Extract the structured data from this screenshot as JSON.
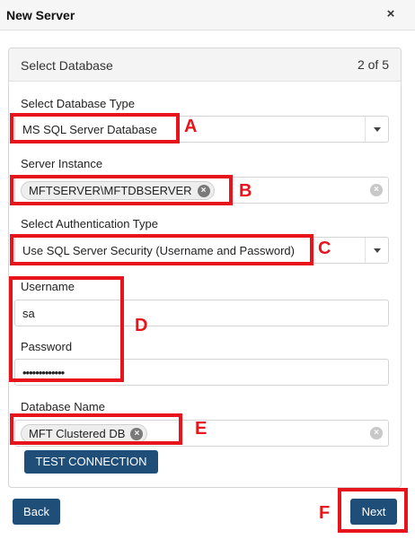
{
  "dialog": {
    "title": "New Server",
    "close_glyph": "×"
  },
  "panel": {
    "title": "Select Database",
    "step": "2 of 5"
  },
  "form": {
    "db_type": {
      "label": "Select Database Type",
      "value": "MS SQL Server Database"
    },
    "server_instance": {
      "label": "Server Instance",
      "chip": "MFTSERVER\\MFTDBSERVER"
    },
    "auth_type": {
      "label": "Select Authentication Type",
      "value": "Use SQL Server Security (Username and Password)"
    },
    "username": {
      "label": "Username",
      "value": "sa"
    },
    "password": {
      "label": "Password",
      "masked": "•••••••••••••"
    },
    "database_name": {
      "label": "Database Name",
      "chip": "MFT Clustered DB"
    },
    "clear_glyph": "×"
  },
  "buttons": {
    "test_connection": "TEST CONNECTION",
    "back": "Back",
    "next": "Next"
  },
  "annotations": {
    "color": "#e8141b",
    "letters": [
      "A",
      "B",
      "C",
      "D",
      "E",
      "F"
    ]
  },
  "icons": [
    "close-icon",
    "chevron-down-icon",
    "clear-icon"
  ]
}
